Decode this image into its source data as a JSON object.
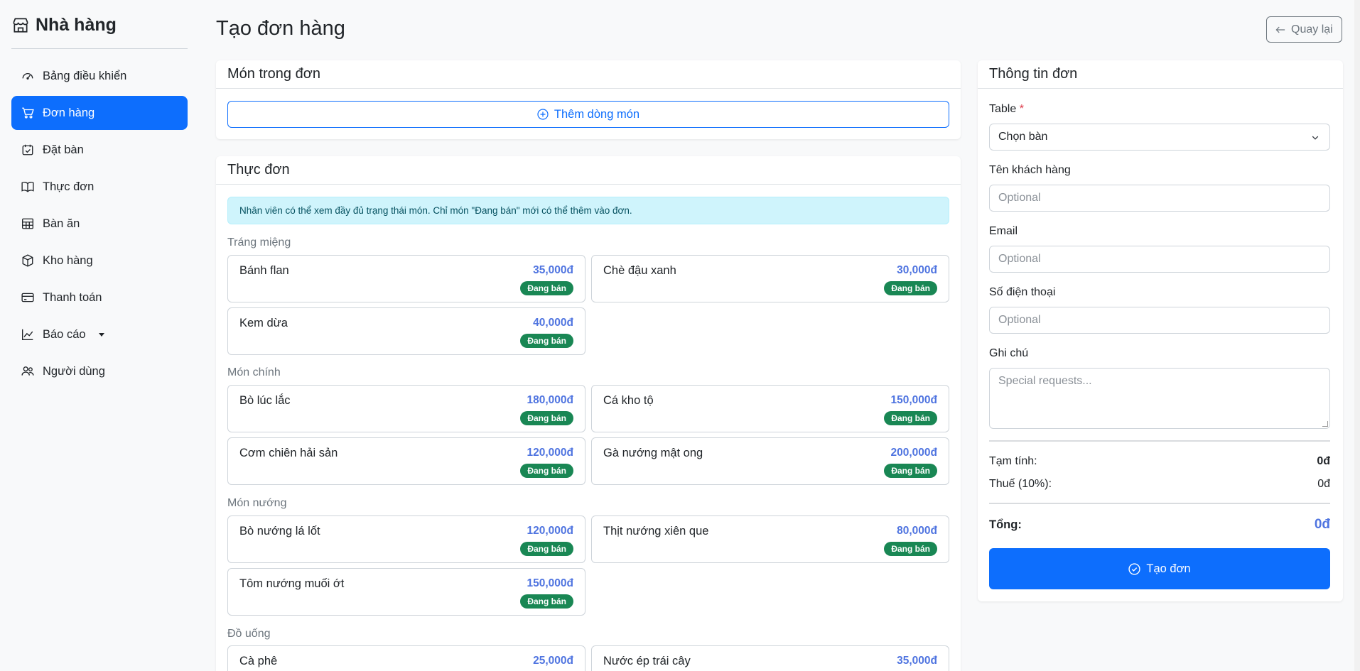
{
  "sidebar": {
    "brand": "Nhà hàng",
    "items": [
      {
        "label": "Bảng điều khiển"
      },
      {
        "label": "Đơn hàng"
      },
      {
        "label": "Đặt bàn"
      },
      {
        "label": "Thực đơn"
      },
      {
        "label": "Bàn ăn"
      },
      {
        "label": "Kho hàng"
      },
      {
        "label": "Thanh toán"
      },
      {
        "label": "Báo cáo"
      },
      {
        "label": "Người dùng"
      }
    ]
  },
  "header": {
    "title": "Tạo đơn hàng",
    "back_label": "Quay lại"
  },
  "order_items": {
    "title": "Món trong đơn",
    "add_line_label": "Thêm dòng món"
  },
  "menu": {
    "title": "Thực đơn",
    "notice": "Nhân viên có thể xem đầy đủ trạng thái món. Chỉ món \"Đang bán\" mới có thể thêm vào đơn.",
    "categories": [
      {
        "name": "Tráng miệng",
        "dishes": [
          {
            "name": "Bánh flan",
            "price": "35,000đ",
            "status": "Đang bán"
          },
          {
            "name": "Chè đậu xanh",
            "price": "30,000đ",
            "status": "Đang bán"
          },
          {
            "name": "Kem dừa",
            "price": "40,000đ",
            "status": "Đang bán"
          }
        ]
      },
      {
        "name": "Món chính",
        "dishes": [
          {
            "name": "Bò lúc lắc",
            "price": "180,000đ",
            "status": "Đang bán"
          },
          {
            "name": "Cá kho tộ",
            "price": "150,000đ",
            "status": "Đang bán"
          },
          {
            "name": "Cơm chiên hải sản",
            "price": "120,000đ",
            "status": "Đang bán"
          },
          {
            "name": "Gà nướng mật ong",
            "price": "200,000đ",
            "status": "Đang bán"
          }
        ]
      },
      {
        "name": "Món nướng",
        "dishes": [
          {
            "name": "Bò nướng lá lốt",
            "price": "120,000đ",
            "status": "Đang bán"
          },
          {
            "name": "Thịt nướng xiên que",
            "price": "80,000đ",
            "status": "Đang bán"
          },
          {
            "name": "Tôm nướng muối ớt",
            "price": "150,000đ",
            "status": "Đang bán"
          }
        ]
      },
      {
        "name": "Đồ uống",
        "dishes": [
          {
            "name": "Cà phê",
            "price": "25,000đ"
          },
          {
            "name": "Nước ép trái cây",
            "price": "35,000đ"
          }
        ]
      }
    ]
  },
  "order_info": {
    "title": "Thông tin đơn",
    "table_label": "Table",
    "table_required": "*",
    "table_value": "Chọn bàn",
    "customer_label": "Tên khách hàng",
    "customer_placeholder": "Optional",
    "email_label": "Email",
    "email_placeholder": "Optional",
    "phone_label": "Số điện thoại",
    "phone_placeholder": "Optional",
    "note_label": "Ghi chú",
    "note_placeholder": "Special requests...",
    "subtotal_label": "Tạm tính:",
    "subtotal_value": "0đ",
    "tax_label": "Thuế (10%):",
    "tax_value": "0đ",
    "total_label": "Tổng:",
    "total_value": "0đ",
    "submit_label": "Tạo đơn"
  },
  "colors": {
    "primary": "#0d6efd",
    "success": "#198754",
    "price": "#4f74e0",
    "info_bg": "#cff4fc"
  }
}
